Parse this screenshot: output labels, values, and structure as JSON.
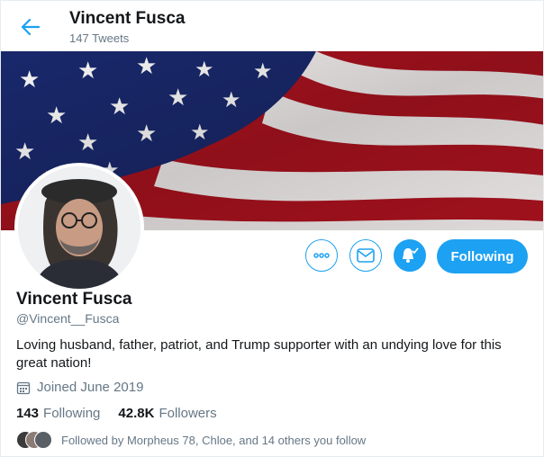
{
  "header": {
    "title": "Vincent Fusca",
    "tweet_count": "147 Tweets"
  },
  "profile": {
    "name": "Vincent Fusca",
    "handle": "@Vincent__Fusca",
    "bio": "Loving husband, father, patriot, and Trump supporter with an undying love for this great nation!",
    "joined": "Joined June 2019",
    "following_count": "143",
    "following_label": "Following",
    "followers_count": "42.8K",
    "followers_label": "Followers",
    "followed_by": "Followed by Morpheus 78, Chloe, and 14 others you follow"
  },
  "actions": {
    "more_icon": "more-icon",
    "message_icon": "envelope-icon",
    "notify_icon": "bell-check-icon",
    "follow_label": "Following"
  },
  "colors": {
    "accent": "#1da1f2",
    "text": "#14171a",
    "muted": "#657786"
  }
}
